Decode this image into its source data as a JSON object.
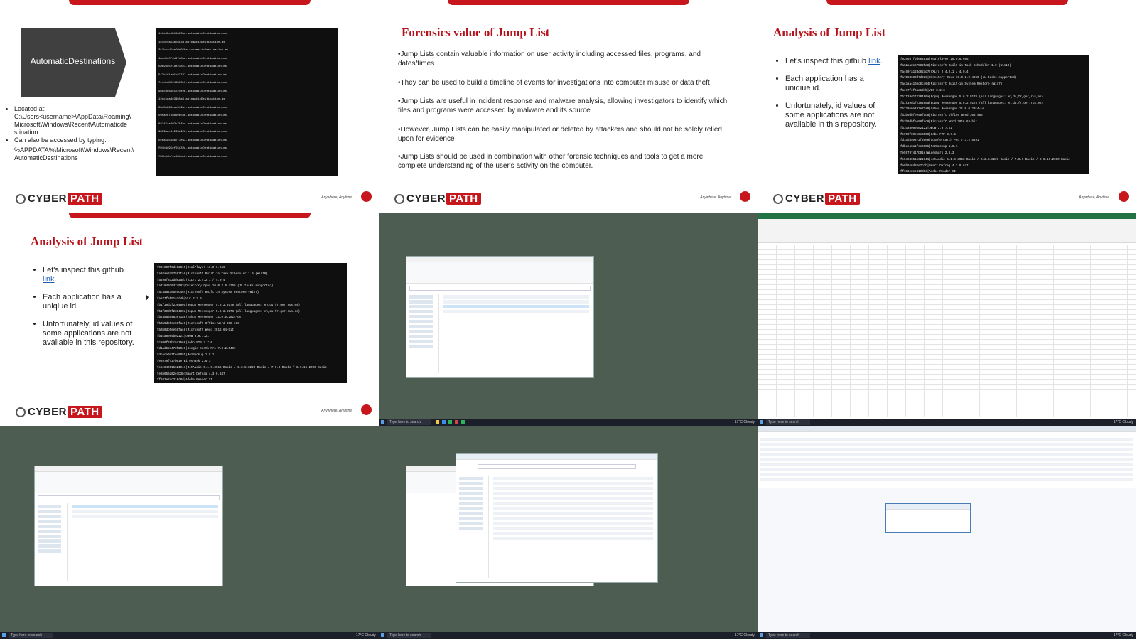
{
  "brand": {
    "cyber": "CYBER",
    "path": "PATH",
    "tagline": "Anywhere, Anytime"
  },
  "slide1": {
    "box_label": "AutomaticDestinations",
    "bullets": [
      "Located at: C:\\Users<username>\\AppData\\Roaming\\ Microsoft\\Windows\\Recent\\Automaticde stination",
      "Can also be accessed by typing:"
    ],
    "path_text": "%APPDATA%\\Microsoft\\Windows\\Recent\\ AutomaticDestinations"
  },
  "slide2": {
    "title": "Forensics value of Jump List",
    "points": [
      "•Jump Lists contain valuable information on user activity including accessed files, programs, and dates/times",
      "•They can be used to build a timeline of events for investigations into computer misuse or data theft",
      "•Jump Lists are useful in incident response and malware analysis, allowing investigators to identify which files and programs were accessed by malware and its source",
      "•However, Jump Lists can be easily manipulated or deleted by attackers and should not be solely relied upon for evidence",
      "•Jump Lists should be used in combination with other forensic techniques and tools to get a more complete understanding of the user's activity on the computer."
    ]
  },
  "slide3": {
    "title": "Analysis of Jump List",
    "b1_pre": "Let's inspect this github",
    "b1_link": "link",
    "b2": "Each application has a uniqiue id.",
    "b3": "Unfortunately,  id values of some applications are not available in this repository."
  },
  "terminal_lines": [
    "f92e607f9de02815|RealPlayer 16.0.6.666",
    "fa02aa2c57582fa8|Microsoft Built-in Task Scheduler 1.0 (Win10)",
    "fa490fa12dd62ad7|VXLrc 2.4.2.1 / 4.0.4",
    "fa7184030d7d083|Directory Opus 10.0.2.0.4269 (JL tasks supported)",
    "fac3aa4105c6c464|Microsoft Built-in System Restore (Win7)",
    "fae77fef51a1d4b|VLC 2.2.6",
    "fb1f39d1f230480a|Bopup Messenger 5.6.2.9178 (all languages: en,du,fr,ger,rus,es)",
    "fb1f39d1f230480a|Bopup Messenger 5.6.2.9178 (all languages: en,du,fr,ger,rus,es)",
    "fb230a9a483e71a8|Yahoo Messenger 11.0.0.2014-us",
    "fb3b0dbfee58fac8|Microsoft Office Word 365 x86",
    "fb3b0dbfee58fac8|Microsoft Word 2016 64-bit",
    "fb1ca8099b02121|oWow 3.0.7.21",
    "fc999f29bc5c3560|Sobo FTP 3.7.6",
    "fd1ad55e472f20e0|Google Earth Pro 7.3.2.5491",
    "fdbaca0a1fec6055|MozBackup 1.5.1",
    "fe5979f417b01e|Wireshark 2.6.3",
    "fe5e840511621941|JetAudio 5.1.9.3018 Basic / 6.2.5.8220 Basic / 7.0.0 Basic / 8.0.16.2000 Basic",
    "fe8b656d82e7b3b|Smart Defrag 4.3.0.847",
    "ff103e2cc310d0d|Adobe Reader XI"
  ],
  "file_rows": [
    "1c7a9be1b15a03ba.automaticDestination-ms",
    "1c4dcfa13bc8d3d.automaticDestination-ms",
    "3c7bb4d5ce59e05ba.automaticDestination-ms",
    "4acd0c0f0d17a8ba.automaticDestination-ms",
    "5d696d521de238c3.automaticDestination-ms",
    "5f7b5f1e01b83767.automaticDestination-ms",
    "7e4dca80246863e3.automaticDestination-ms",
    "9b9cdc69c1c24e2b.automaticDestination-ms",
    "12dc1ea8e34b5a6.automaticDestination-ms",
    "28c8b86deab549a1.automaticDestination-ms",
    "590aee7bdd69b59b.automaticDestination-ms",
    "6824f4a902c78fbd.automaticDestination-ms",
    "9839aec31243a928.automaticDestination-ms",
    "ccba5a5986c77e43.automaticDestination-ms",
    "f01b4d95cf55d32a.automaticDestination-ms",
    "fb3b0dbfee58fac8.automaticDestination-ms"
  ],
  "taskbar": {
    "search": "Type here to search",
    "weather": "17°C  Cloudy"
  },
  "colors": {
    "brand_red": "#c8161d",
    "desktop": "#4d5d52",
    "terminal_bg": "#0f0f0f",
    "excel_green": "#217346"
  }
}
